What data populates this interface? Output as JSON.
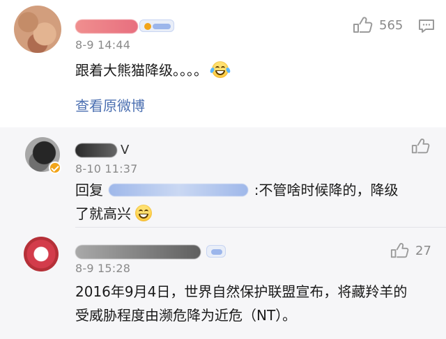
{
  "main_comment": {
    "username_blurred": "",
    "time": "8-9 14:44",
    "text": "跟着大熊猫降级。。。。",
    "emoji": "laugh-cry-emoji",
    "like_count": "565",
    "view_original_label": "查看原微博"
  },
  "replies": [
    {
      "username_blurred": "",
      "username_suffix": "V",
      "time": "8-10 11:37",
      "reply_prefix": "回复",
      "reply_suffix": ":不管啥时候降的，降级了就高兴",
      "emoji": "grin-emoji",
      "like_count": ""
    },
    {
      "username_blurred": "",
      "time": "8-9 15:28",
      "text": "2016年9月4日，世界自然保护联盟宣布，将藏羚羊的受威胁程度由濒危降为近危（NT）。",
      "like_count": "27"
    }
  ],
  "icons": {
    "like": "thumbs-up-icon",
    "comment": "comment-icon",
    "verified": "verified-badge-icon"
  },
  "colors": {
    "link": "#4b6fb1",
    "meta_gray": "#8a8a8a",
    "reply_background": "#f6f6f8",
    "verified": "#f2a51a"
  }
}
